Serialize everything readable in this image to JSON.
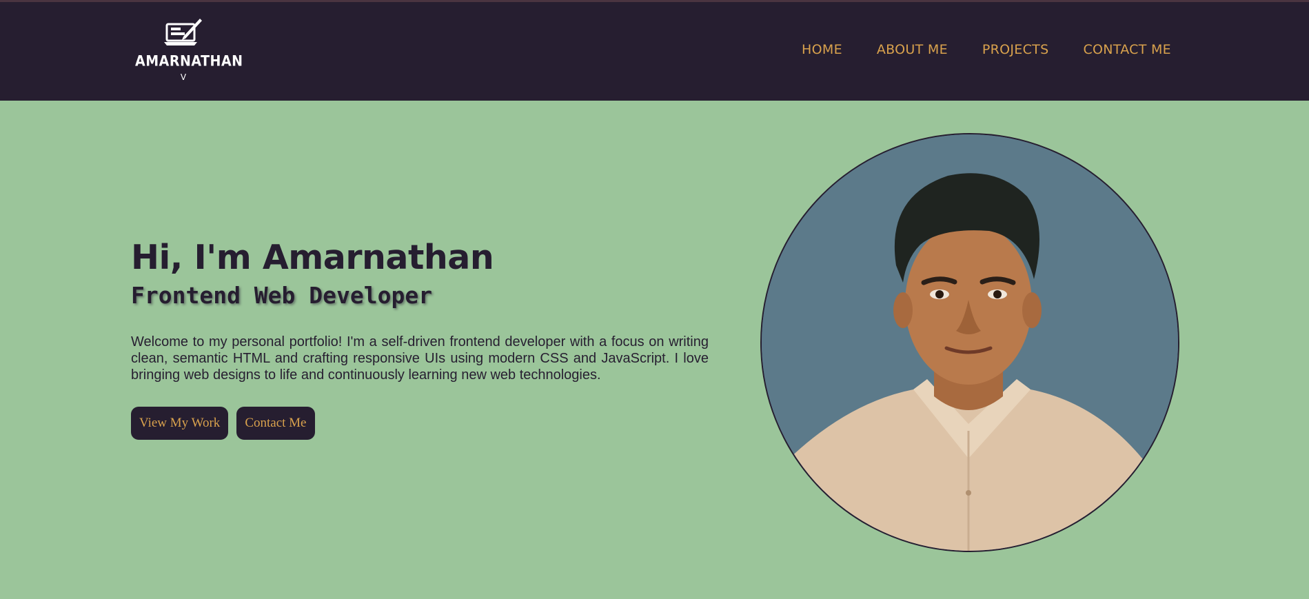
{
  "brand": {
    "name": "AMARNATHAN",
    "initial": "V",
    "logo_icon": "laptop-pen-icon"
  },
  "nav": {
    "items": [
      {
        "label": "HOME"
      },
      {
        "label": "ABOUT ME"
      },
      {
        "label": "PROJECTS"
      },
      {
        "label": "CONTACT ME"
      }
    ]
  },
  "hero": {
    "greeting": "Hi, I'm Amarnathan",
    "role": "Frontend Web Developer",
    "intro": "Welcome to my personal portfolio! I'm a self-driven frontend developer with a focus on writing clean, semantic HTML and crafting responsive UIs using modern CSS and JavaScript. I love bringing web designs to life and continuously learning new web technologies.",
    "buttons": {
      "view_work": "View My Work",
      "contact": "Contact Me"
    },
    "portrait": "profile-photo"
  },
  "colors": {
    "header_bg": "#261e30",
    "page_bg": "#9bc59a",
    "accent": "#d9a24d",
    "text_dark": "#261e30",
    "portrait_bg": "#5c7a8a"
  }
}
